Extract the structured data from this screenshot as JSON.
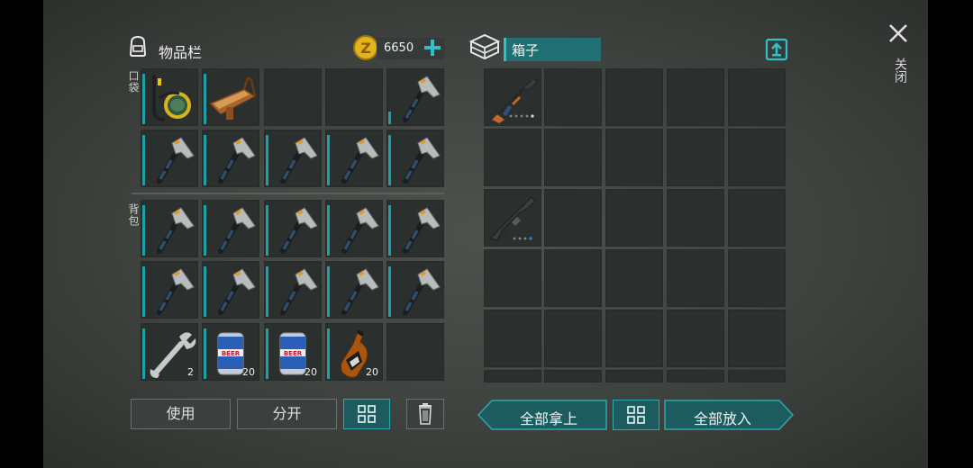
{
  "inventory": {
    "title": "物品栏",
    "coins": "6650",
    "pocket_tag": "口袋",
    "backpack_tag": "背包",
    "rows": [
      [
        {
          "item": "snorkel-goggles",
          "count": ""
        },
        {
          "item": "wooden-trough",
          "count": ""
        },
        {
          "item": "empty",
          "count": ""
        },
        {
          "item": "empty",
          "count": ""
        },
        {
          "item": "hatchet",
          "count": ""
        }
      ],
      [
        {
          "item": "hatchet",
          "count": ""
        },
        {
          "item": "hatchet",
          "count": ""
        },
        {
          "item": "hatchet",
          "count": ""
        },
        {
          "item": "hatchet",
          "count": ""
        },
        {
          "item": "hatchet",
          "count": ""
        }
      ],
      [
        {
          "item": "hatchet",
          "count": ""
        },
        {
          "item": "hatchet",
          "count": ""
        },
        {
          "item": "hatchet",
          "count": ""
        },
        {
          "item": "hatchet",
          "count": ""
        },
        {
          "item": "hatchet",
          "count": ""
        }
      ],
      [
        {
          "item": "hatchet",
          "count": ""
        },
        {
          "item": "hatchet",
          "count": ""
        },
        {
          "item": "hatchet",
          "count": ""
        },
        {
          "item": "hatchet",
          "count": ""
        },
        {
          "item": "hatchet",
          "count": ""
        }
      ],
      [
        {
          "item": "wrench",
          "count": "2"
        },
        {
          "item": "beer-can",
          "count": "20"
        },
        {
          "item": "beer-can",
          "count": "20"
        },
        {
          "item": "whiskey-bottle",
          "count": "20"
        },
        {
          "item": "empty",
          "count": ""
        }
      ]
    ],
    "use_label": "使用",
    "split_label": "分开"
  },
  "box": {
    "name": "箱子",
    "rows": [
      [
        {
          "item": "ak-rifle"
        },
        {
          "item": "empty"
        },
        {
          "item": "empty"
        },
        {
          "item": "empty"
        },
        {
          "item": "empty"
        }
      ],
      [
        {
          "item": "empty"
        },
        {
          "item": "empty"
        },
        {
          "item": "empty"
        },
        {
          "item": "empty"
        },
        {
          "item": "empty"
        }
      ],
      [
        {
          "item": "m16-rifle"
        },
        {
          "item": "empty"
        },
        {
          "item": "empty"
        },
        {
          "item": "empty"
        },
        {
          "item": "empty"
        }
      ],
      [
        {
          "item": "empty"
        },
        {
          "item": "empty"
        },
        {
          "item": "empty"
        },
        {
          "item": "empty"
        },
        {
          "item": "empty"
        }
      ],
      [
        {
          "item": "empty"
        },
        {
          "item": "empty"
        },
        {
          "item": "empty"
        },
        {
          "item": "empty"
        },
        {
          "item": "empty"
        }
      ]
    ],
    "take_all_label": "全部拿上",
    "put_all_label": "全部放入"
  },
  "close": {
    "label": "关闭",
    "icon": "close-icon"
  },
  "colors": {
    "accent": "#1ea0a8",
    "button_teal": "#1c5c5f",
    "coin": "#e3b31c"
  }
}
